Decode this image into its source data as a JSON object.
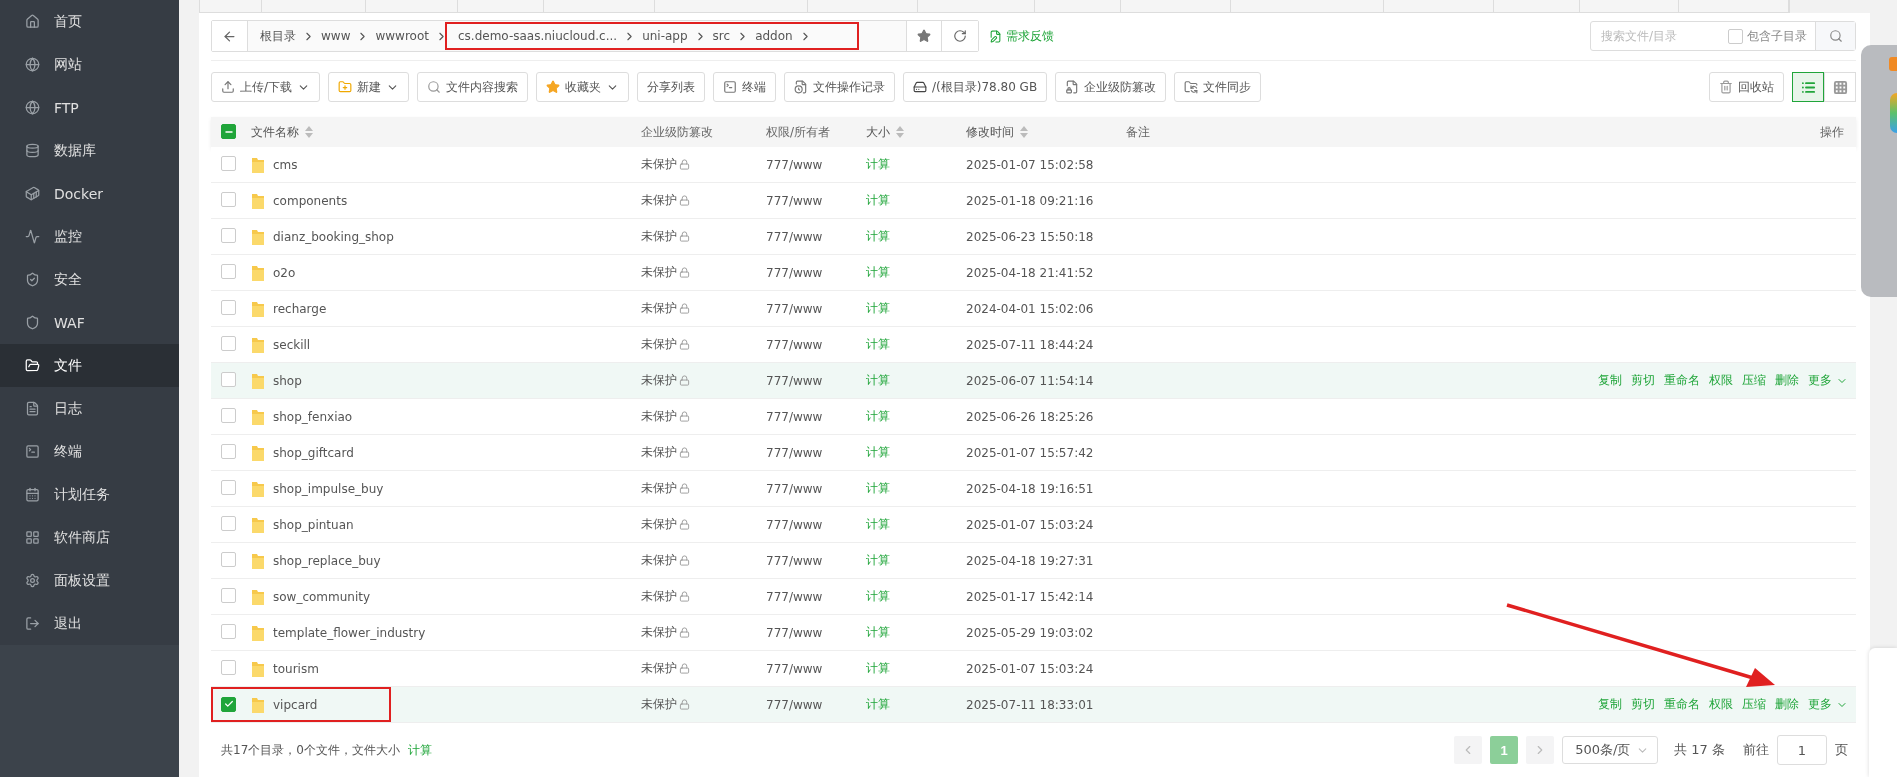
{
  "sidebar": {
    "items": [
      {
        "label": "首页",
        "selected": false
      },
      {
        "label": "网站",
        "selected": false
      },
      {
        "label": "FTP",
        "selected": false
      },
      {
        "label": "数据库",
        "selected": false
      },
      {
        "label": "Docker",
        "selected": false
      },
      {
        "label": "监控",
        "selected": false
      },
      {
        "label": "安全",
        "selected": false
      },
      {
        "label": "WAF",
        "selected": false
      },
      {
        "label": "文件",
        "selected": true
      },
      {
        "label": "日志",
        "selected": false
      },
      {
        "label": "终端",
        "selected": false
      },
      {
        "label": "计划任务",
        "selected": false
      },
      {
        "label": "软件商店",
        "selected": false
      },
      {
        "label": "面板设置",
        "selected": false
      },
      {
        "label": "退出",
        "selected": false
      }
    ]
  },
  "breadcrumb": {
    "segments": [
      {
        "label": "根目录",
        "marked": false
      },
      {
        "label": "www",
        "marked": false
      },
      {
        "label": "wwwroot",
        "marked": false
      },
      {
        "label": "cs.demo-saas.niucloud.c...",
        "marked": true
      },
      {
        "label": "uni-app",
        "marked": true
      },
      {
        "label": "src",
        "marked": true
      },
      {
        "label": "addon",
        "marked": true
      }
    ]
  },
  "feedback_link": "需求反馈",
  "search": {
    "placeholder": "搜索文件/目录",
    "subdir_label": "包含子目录",
    "subdir_checked": false
  },
  "toolbar": [
    {
      "label": "上传/下载",
      "dropdown": true
    },
    {
      "label": "新建",
      "dropdown": true
    },
    {
      "label": "文件内容搜索",
      "dropdown": false
    },
    {
      "label": "收藏夹",
      "dropdown": true
    },
    {
      "label": "分享列表",
      "dropdown": false
    },
    {
      "label": "终端",
      "dropdown": false
    },
    {
      "label": "文件操作记录",
      "dropdown": false
    },
    {
      "label": "/(根目录)78.80 GB",
      "dropdown": false
    },
    {
      "label": "企业级防篡改",
      "dropdown": false
    },
    {
      "label": "文件同步",
      "dropdown": false
    }
  ],
  "recycle_button": "回收站",
  "view_modes": [
    {
      "kind": "list",
      "selected": true
    },
    {
      "kind": "grid",
      "selected": false
    }
  ],
  "table": {
    "select_all_indeterminate": true,
    "columns": [
      {
        "label": "文件名称",
        "sortable": true
      },
      {
        "label": "企业级防篡改",
        "sortable": false
      },
      {
        "label": "权限/所有者",
        "sortable": false
      },
      {
        "label": "大小",
        "sortable": true
      },
      {
        "label": "修改时间",
        "sortable": true
      },
      {
        "label": "备注",
        "sortable": false
      },
      {
        "label": "操作",
        "sortable": false
      }
    ],
    "rows": [
      {
        "name": "cms",
        "protection": "未保护",
        "permission": "777/www",
        "size": "计算",
        "modified": "2025-01-07 15:02:58",
        "checked": false,
        "highlighted": false,
        "marked": false,
        "actions": []
      },
      {
        "name": "components",
        "protection": "未保护",
        "permission": "777/www",
        "size": "计算",
        "modified": "2025-01-18 09:21:16",
        "checked": false,
        "highlighted": false,
        "marked": false,
        "actions": []
      },
      {
        "name": "dianz_booking_shop",
        "protection": "未保护",
        "permission": "777/www",
        "size": "计算",
        "modified": "2025-06-23 15:50:18",
        "checked": false,
        "highlighted": false,
        "marked": false,
        "actions": []
      },
      {
        "name": "o2o",
        "protection": "未保护",
        "permission": "777/www",
        "size": "计算",
        "modified": "2025-04-18 21:41:52",
        "checked": false,
        "highlighted": false,
        "marked": false,
        "actions": []
      },
      {
        "name": "recharge",
        "protection": "未保护",
        "permission": "777/www",
        "size": "计算",
        "modified": "2024-04-01 15:02:06",
        "checked": false,
        "highlighted": false,
        "marked": false,
        "actions": []
      },
      {
        "name": "seckill",
        "protection": "未保护",
        "permission": "777/www",
        "size": "计算",
        "modified": "2025-07-11 18:44:24",
        "checked": false,
        "highlighted": false,
        "marked": false,
        "actions": []
      },
      {
        "name": "shop",
        "protection": "未保护",
        "permission": "777/www",
        "size": "计算",
        "modified": "2025-06-07 11:54:14",
        "checked": false,
        "highlighted": true,
        "marked": false,
        "actions": [
          "复制",
          "剪切",
          "重命名",
          "权限",
          "压缩",
          "删除",
          "更多"
        ]
      },
      {
        "name": "shop_fenxiao",
        "protection": "未保护",
        "permission": "777/www",
        "size": "计算",
        "modified": "2025-06-26 18:25:26",
        "checked": false,
        "highlighted": false,
        "marked": false,
        "actions": []
      },
      {
        "name": "shop_giftcard",
        "protection": "未保护",
        "permission": "777/www",
        "size": "计算",
        "modified": "2025-01-07 15:57:42",
        "checked": false,
        "highlighted": false,
        "marked": false,
        "actions": []
      },
      {
        "name": "shop_impulse_buy",
        "protection": "未保护",
        "permission": "777/www",
        "size": "计算",
        "modified": "2025-04-18 19:16:51",
        "checked": false,
        "highlighted": false,
        "marked": false,
        "actions": []
      },
      {
        "name": "shop_pintuan",
        "protection": "未保护",
        "permission": "777/www",
        "size": "计算",
        "modified": "2025-01-07 15:03:24",
        "checked": false,
        "highlighted": false,
        "marked": false,
        "actions": []
      },
      {
        "name": "shop_replace_buy",
        "protection": "未保护",
        "permission": "777/www",
        "size": "计算",
        "modified": "2025-04-18 19:27:31",
        "checked": false,
        "highlighted": false,
        "marked": false,
        "actions": []
      },
      {
        "name": "sow_community",
        "protection": "未保护",
        "permission": "777/www",
        "size": "计算",
        "modified": "2025-01-17 15:42:14",
        "checked": false,
        "highlighted": false,
        "marked": false,
        "actions": []
      },
      {
        "name": "template_flower_industry",
        "protection": "未保护",
        "permission": "777/www",
        "size": "计算",
        "modified": "2025-05-29 19:03:02",
        "checked": false,
        "highlighted": false,
        "marked": false,
        "actions": []
      },
      {
        "name": "tourism",
        "protection": "未保护",
        "permission": "777/www",
        "size": "计算",
        "modified": "2025-01-07 15:03:24",
        "checked": false,
        "highlighted": false,
        "marked": false,
        "actions": []
      },
      {
        "name": "vipcard",
        "protection": "未保护",
        "permission": "777/www",
        "size": "计算",
        "modified": "2025-07-11 18:33:01",
        "checked": true,
        "highlighted": true,
        "marked": true,
        "actions": [
          "复制",
          "剪切",
          "重命名",
          "权限",
          "压缩",
          "删除",
          "更多"
        ]
      }
    ]
  },
  "footer": {
    "summary": "共17个目录，0个文件，文件大小",
    "calc_link": "计算"
  },
  "pagination": {
    "pages": [
      {
        "label": "1",
        "selected": true
      }
    ],
    "page_size": "500条/页",
    "total": "共 17 条",
    "goto_label": "前往",
    "goto_value": "1",
    "page_suffix": "页"
  }
}
